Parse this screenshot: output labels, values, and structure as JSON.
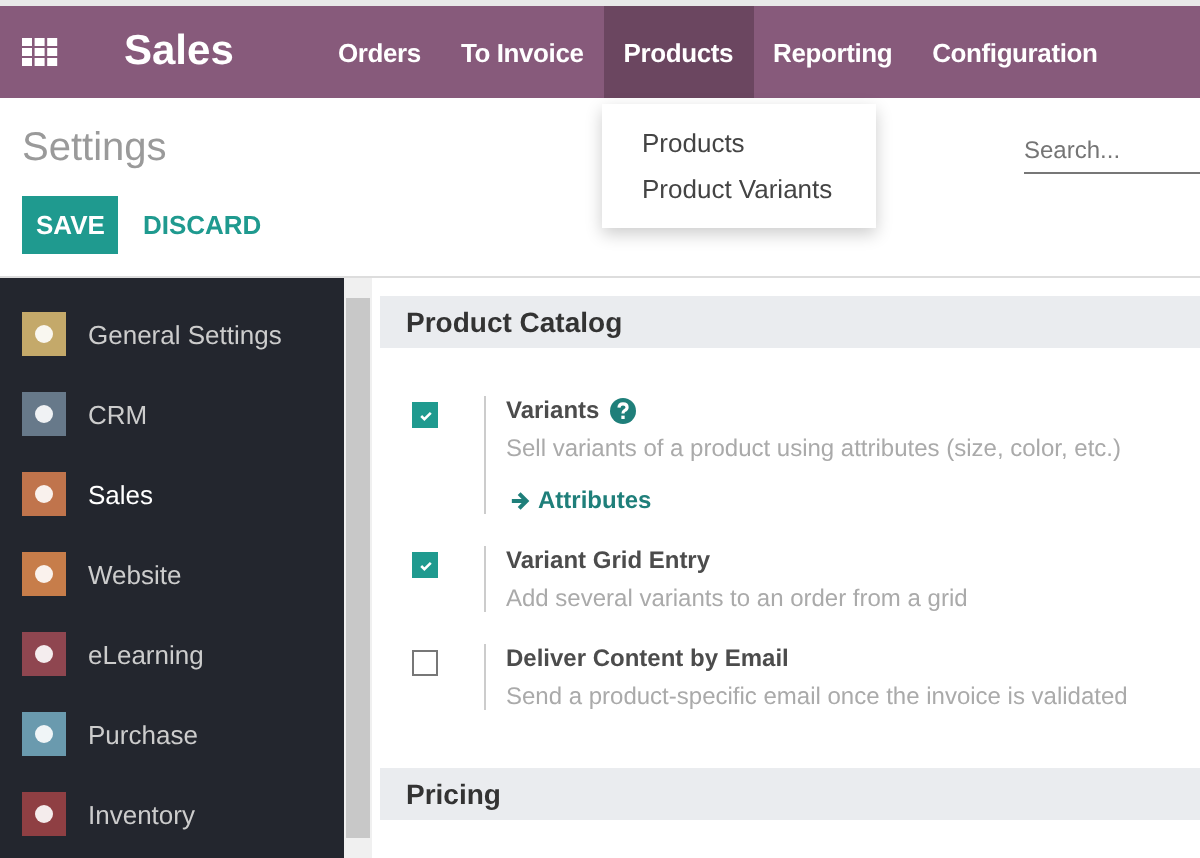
{
  "navbar": {
    "app_name": "Sales",
    "menu": [
      {
        "label": "Orders",
        "selected": false
      },
      {
        "label": "To Invoice",
        "selected": false
      },
      {
        "label": "Products",
        "selected": true
      },
      {
        "label": "Reporting",
        "selected": false
      },
      {
        "label": "Configuration",
        "selected": false
      }
    ]
  },
  "dropdown": {
    "items": [
      "Products",
      "Product Variants"
    ]
  },
  "control_panel": {
    "title": "Settings",
    "search": {
      "placeholder": "Search..."
    },
    "buttons": [
      "SAVE",
      "DISCARD"
    ]
  },
  "sidebar": {
    "items": [
      {
        "label": "General Settings",
        "color": "#c4a96a",
        "selected": false
      },
      {
        "label": "CRM",
        "color": "#67798a",
        "selected": false
      },
      {
        "label": "Sales",
        "color": "#c0744c",
        "selected": true
      },
      {
        "label": "Website",
        "color": "#c77d4a",
        "selected": false
      },
      {
        "label": "eLearning",
        "color": "#8f4650",
        "selected": false
      },
      {
        "label": "Purchase",
        "color": "#6a9aae",
        "selected": false
      },
      {
        "label": "Inventory",
        "color": "#8f3f43",
        "selected": false
      }
    ]
  },
  "sections": [
    {
      "title": "Product Catalog",
      "settings": [
        {
          "title": "Variants",
          "help": true,
          "description": "Sell variants of a product using attributes (size, color, etc.)",
          "link": "Attributes",
          "checked": true
        },
        {
          "title": "Variant Grid Entry",
          "help": false,
          "description": "Add several variants to an order from a grid",
          "checked": true
        },
        {
          "title": "Deliver Content by Email",
          "help": false,
          "description": "Send a product-specific email once the invoice is validated",
          "checked": false
        }
      ]
    },
    {
      "title": "Pricing"
    }
  ]
}
